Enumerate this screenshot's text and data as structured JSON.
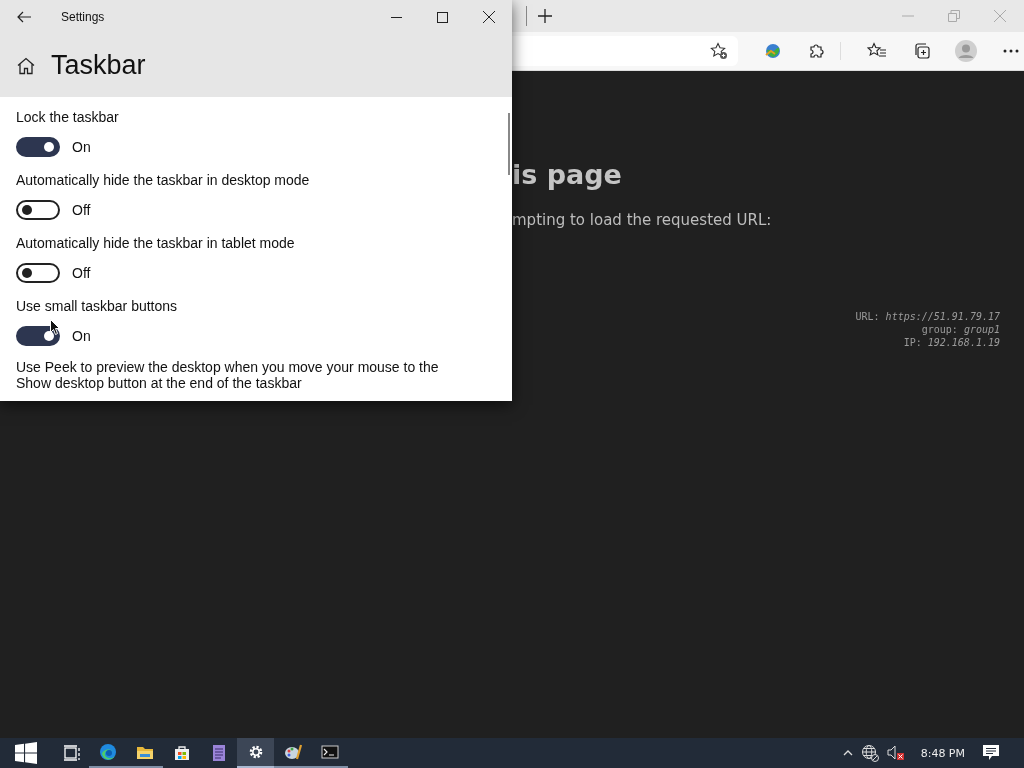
{
  "browser": {
    "heading": "is page",
    "message": "mpting to load the requested URL:",
    "info": [
      "URL: *https://51.91.79.17*",
      "group: *group1*",
      "IP: *192.168.1.19*"
    ]
  },
  "settings_window": {
    "title": "Settings",
    "heading": "Taskbar",
    "toggles": [
      {
        "label": "Lock the taskbar",
        "on": true,
        "state_text": "On"
      },
      {
        "label": "Automatically hide the taskbar in desktop mode",
        "on": false,
        "state_text": "Off"
      },
      {
        "label": "Automatically hide the taskbar in tablet mode",
        "on": false,
        "state_text": "Off"
      },
      {
        "label": "Use small taskbar buttons",
        "on": true,
        "state_text": "On"
      }
    ],
    "description": "Use Peek to preview the desktop when you move your mouse to the Show desktop button at the end of the taskbar"
  },
  "taskbar": {
    "apps": [
      {
        "kind": "taskview",
        "selected": false,
        "running": false
      },
      {
        "kind": "edge",
        "selected": false,
        "running": true
      },
      {
        "kind": "explorer",
        "selected": false,
        "running": true
      },
      {
        "kind": "store",
        "selected": false,
        "running": false
      },
      {
        "kind": "notes",
        "selected": false,
        "running": false
      },
      {
        "kind": "settings",
        "selected": true,
        "running": true
      },
      {
        "kind": "paint",
        "selected": false,
        "running": true
      },
      {
        "kind": "console",
        "selected": false,
        "running": true
      }
    ],
    "clock": "8:48 PM"
  }
}
